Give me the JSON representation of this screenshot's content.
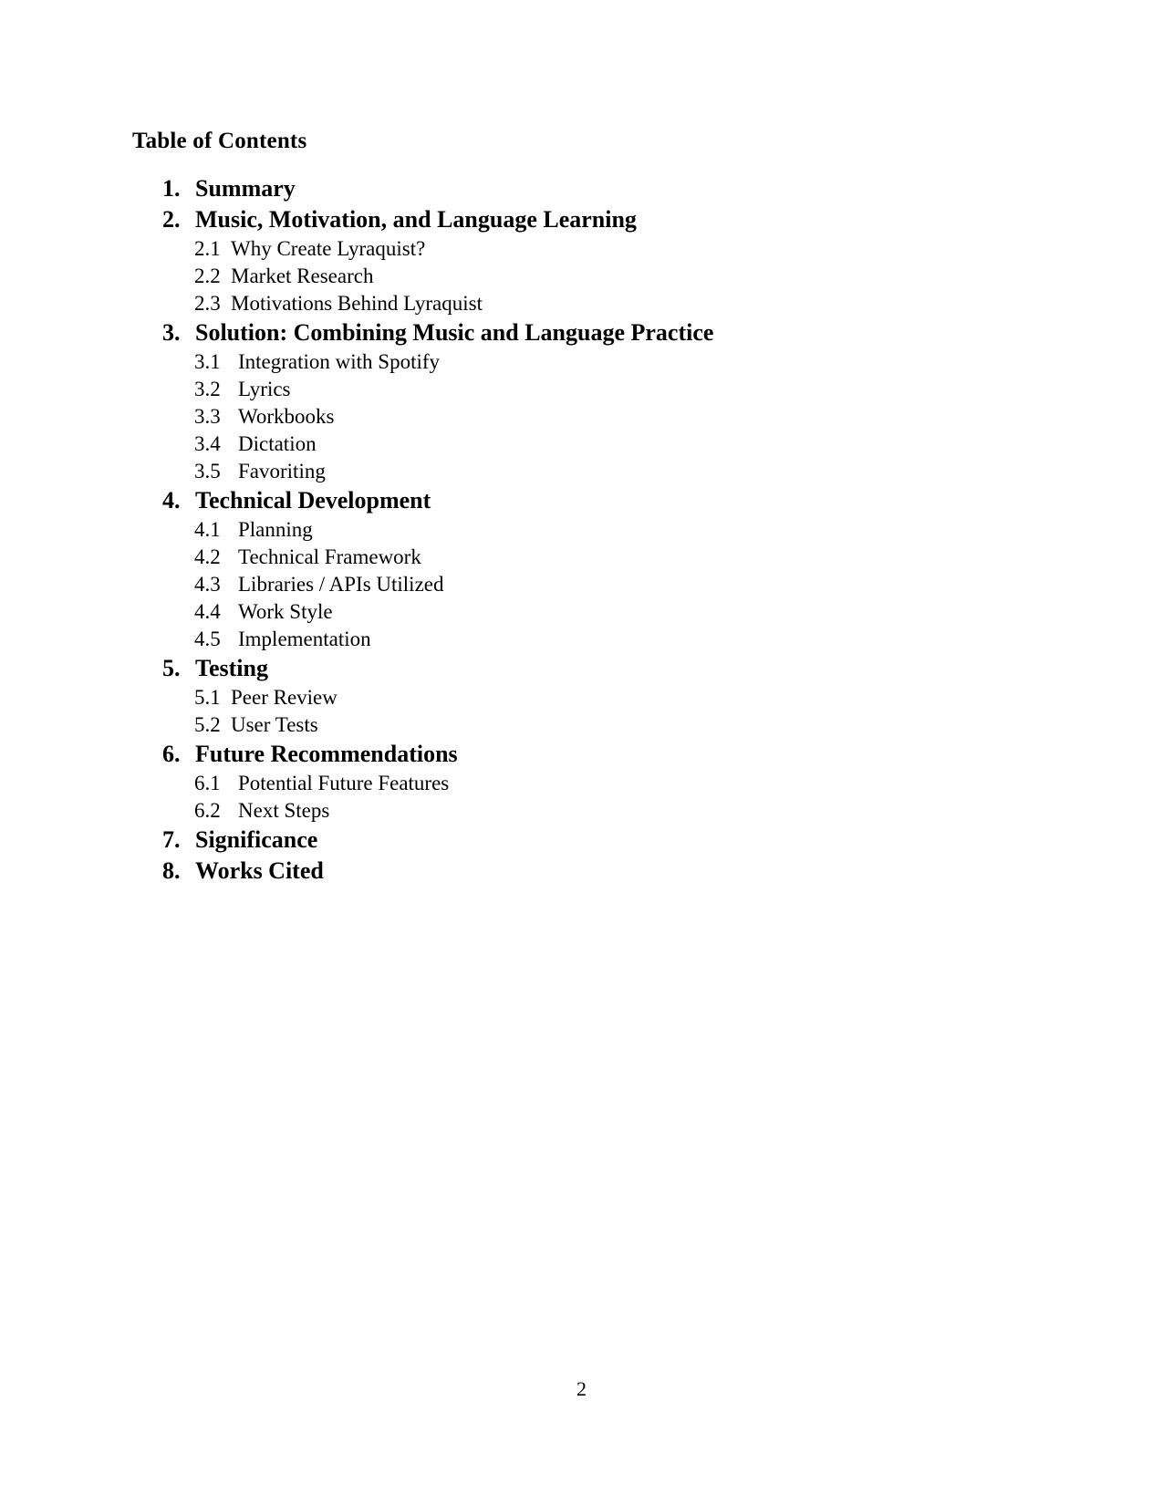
{
  "document": {
    "heading": "Table of Contents",
    "page_number": "2",
    "entries": [
      {
        "number": "1.",
        "label": "Summary",
        "subitems": []
      },
      {
        "number": "2.",
        "label": "Music, Motivation, and Language Learning",
        "subitems": [
          {
            "number": "2.1",
            "label": "Why Create Lyraquist?",
            "spacing": "narrow"
          },
          {
            "number": "2.2",
            "label": "Market Research",
            "spacing": "narrow"
          },
          {
            "number": "2.3",
            "label": "Motivations Behind Lyraquist",
            "spacing": "narrow"
          }
        ]
      },
      {
        "number": "3.",
        "label": "Solution: Combining Music and Language Practice",
        "subitems": [
          {
            "number": "3.1",
            "label": "Integration with Spotify",
            "spacing": "wide"
          },
          {
            "number": "3.2",
            "label": "Lyrics",
            "spacing": "wide"
          },
          {
            "number": "3.3",
            "label": "Workbooks",
            "spacing": "wide"
          },
          {
            "number": "3.4",
            "label": "Dictation",
            "spacing": "wide"
          },
          {
            "number": "3.5",
            "label": "Favoriting",
            "spacing": "wide"
          }
        ]
      },
      {
        "number": "4.",
        "label": "Technical Development",
        "subitems": [
          {
            "number": "4.1",
            "label": "Planning",
            "spacing": "wide"
          },
          {
            "number": "4.2",
            "label": "Technical Framework",
            "spacing": "wide"
          },
          {
            "number": "4.3",
            "label": "Libraries / APIs Utilized",
            "spacing": "wide"
          },
          {
            "number": "4.4",
            "label": "Work Style",
            "spacing": "wide"
          },
          {
            "number": "4.5",
            "label": "Implementation",
            "spacing": "wide"
          }
        ]
      },
      {
        "number": "5.",
        "label": "Testing",
        "subitems": [
          {
            "number": "5.1",
            "label": "Peer Review",
            "spacing": "narrow"
          },
          {
            "number": "5.2",
            "label": "User Tests",
            "spacing": "narrow"
          }
        ]
      },
      {
        "number": "6.",
        "label": "Future Recommendations",
        "subitems": [
          {
            "number": "6.1",
            "label": "Potential Future Features",
            "spacing": "wide"
          },
          {
            "number": "6.2",
            "label": "Next Steps",
            "spacing": "wide"
          }
        ]
      },
      {
        "number": "7.",
        "label": "Significance",
        "subitems": []
      },
      {
        "number": "8.",
        "label": "Works Cited",
        "subitems": []
      }
    ]
  }
}
